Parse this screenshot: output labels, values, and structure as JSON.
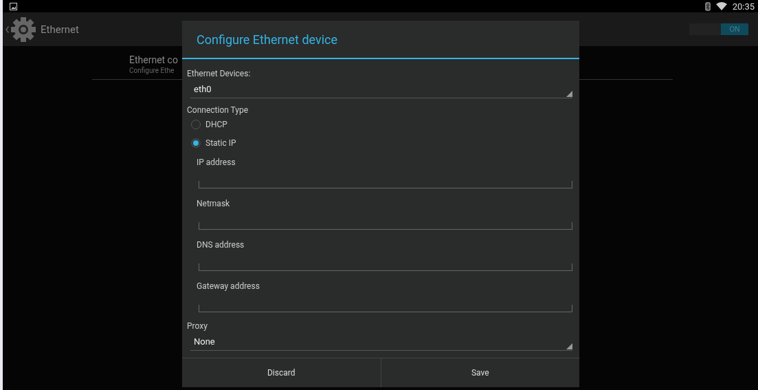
{
  "status_bar": {
    "time": "20:35"
  },
  "action_bar": {
    "title": "Ethernet",
    "switch": {
      "label": "ON",
      "on": true
    }
  },
  "background_list": [
    {
      "title": "Ethernet co",
      "subtitle": "Configure Ethe"
    }
  ],
  "dialog": {
    "title": "Configure Ethernet device",
    "devices": {
      "label": "Ethernet Devices:",
      "value": "eth0"
    },
    "connection": {
      "label": "Connection Type",
      "options": [
        {
          "label": "DHCP",
          "selected": false
        },
        {
          "label": "Static IP",
          "selected": true
        }
      ]
    },
    "fields": [
      {
        "label": "IP address"
      },
      {
        "label": "Netmask"
      },
      {
        "label": "DNS address"
      },
      {
        "label": "Gateway address"
      }
    ],
    "proxy": {
      "label": "Proxy",
      "value": "None"
    },
    "buttons": [
      "Discard",
      "Save"
    ]
  }
}
